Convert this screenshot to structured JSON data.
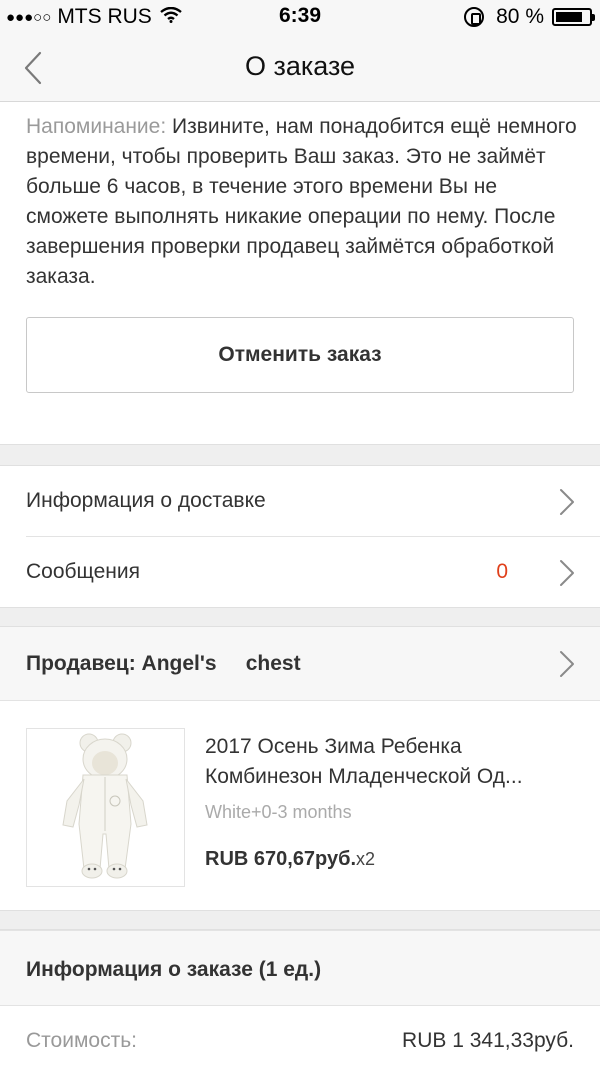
{
  "status_bar": {
    "signal_dots": "●●●○○",
    "carrier": "MTS RUS",
    "time": "6:39",
    "battery": "80 %",
    "battery_level": 0.8
  },
  "nav": {
    "title": "О заказе",
    "back_icon": "chevron-left-icon"
  },
  "notice": {
    "label": "Напоминание:",
    "text": " Извините, нам понадобится ещё немного времени, чтобы проверить Ваш заказ. Это не займёт больше 6 часов, в течение этого времени Вы не сможете выполнять никакие операции по нему. После завершения проверки продавец займётся обработкой заказа."
  },
  "actions": {
    "cancel_label": "Отменить заказ"
  },
  "menu": {
    "delivery_label": "Информация о доставке",
    "messages_label": "Сообщения",
    "messages_count": "0"
  },
  "seller": {
    "label": "Продавец: Angel's     chest"
  },
  "product": {
    "name_line1": "2017 Осень Зима Ребенка",
    "name_line2": "Комбинезон Младенческой Од...",
    "variant": "White+0-3 months",
    "price": "RUB 670,67руб.",
    "quantity": "x2"
  },
  "order_info": {
    "title": "Информация о заказе (1 ед.)",
    "cost_label": "Стоимость:",
    "cost_value": "RUB 1 341,33руб."
  },
  "colors": {
    "accent_count": "#e0401b",
    "muted": "#9a9a9a",
    "section_bg": "#efefef"
  }
}
